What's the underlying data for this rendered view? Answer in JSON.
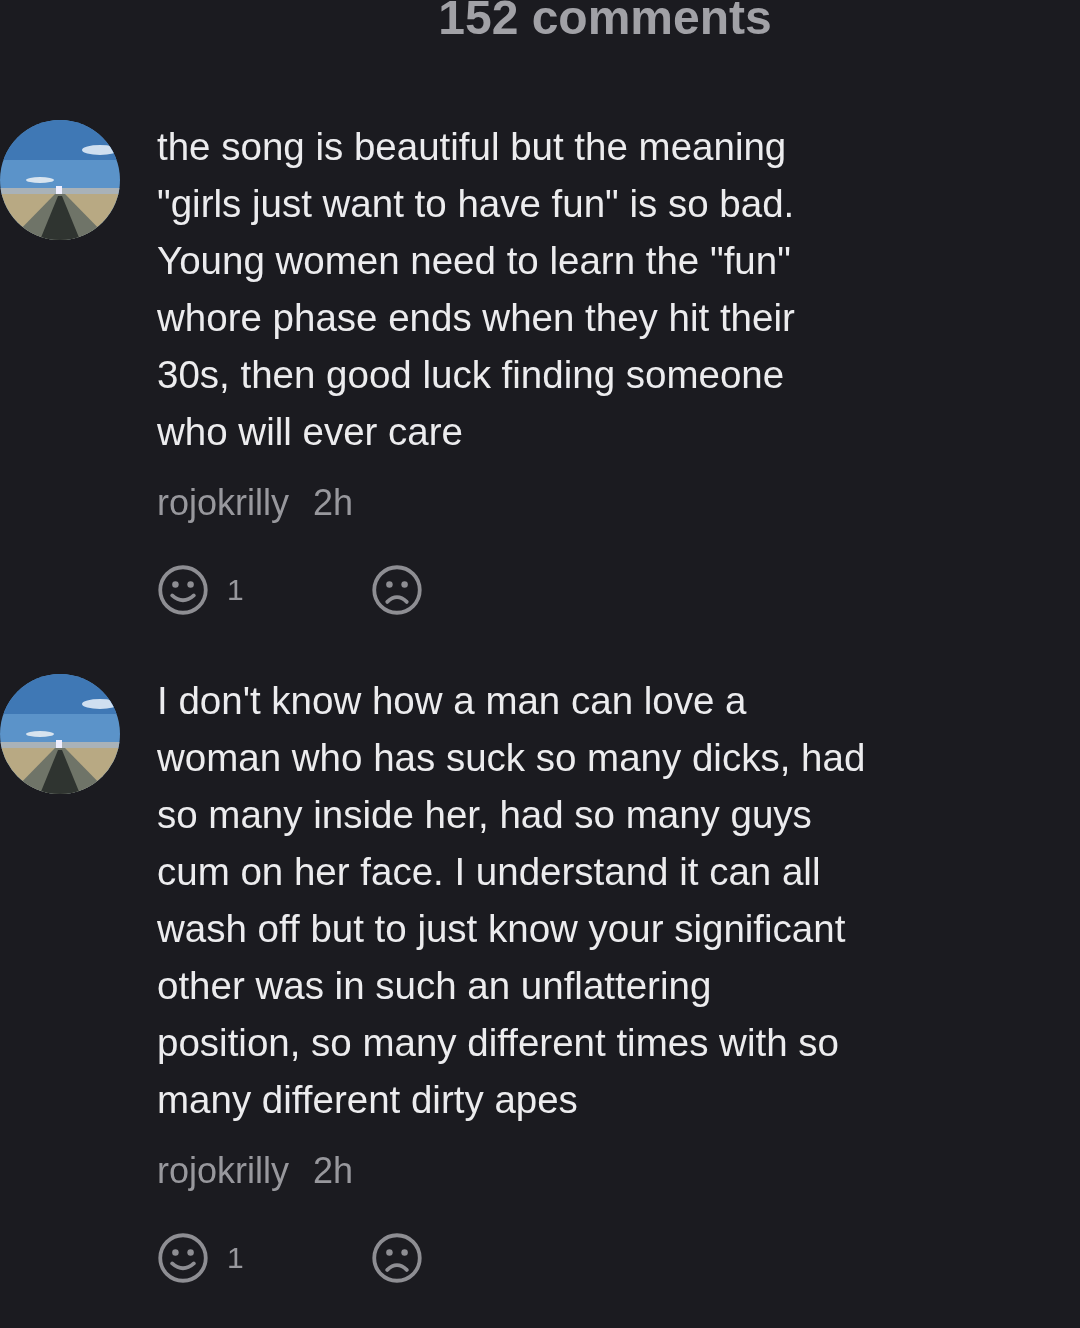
{
  "header": {
    "title": "152 comments"
  },
  "comments": [
    {
      "text": "the song is beautiful but the meaning\n\"girls just want to have fun\" is so bad.\nYoung women need to learn the \"fun\"\nwhore phase ends when they hit their\n30s, then good luck finding someone\nwho will ever care",
      "author": "rojokrilly",
      "time": "2h",
      "likes": "1"
    },
    {
      "text": "I don't know how a man can love a\nwoman who has suck so many dicks, had\nso many inside her, had so many guys\ncum on her face. I understand it can all\nwash off but to just know your significant\nother was in such an unflattering\nposition, so many different times with so\nmany different dirty apes",
      "author": "rojokrilly",
      "time": "2h",
      "likes": "1"
    }
  ]
}
